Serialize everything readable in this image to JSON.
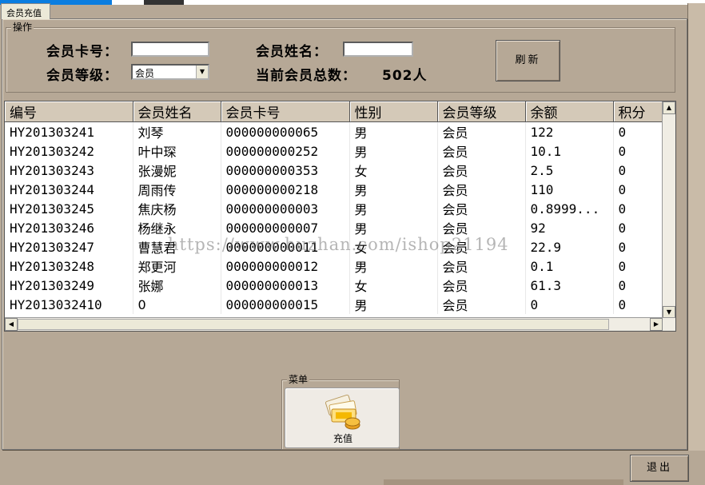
{
  "tab": {
    "label": "会员充值"
  },
  "operation": {
    "title": "操作",
    "card_no_label": "会员卡号：",
    "card_no_value": "",
    "name_label": "会员姓名：",
    "name_value": "",
    "level_label": "会员等级：",
    "level_selected": "会员",
    "total_label": "当前会员总数：",
    "total_value": "502人",
    "refresh_label": "刷新"
  },
  "grid": {
    "columns": [
      "编号",
      "会员姓名",
      "会员卡号",
      "性别",
      "会员等级",
      "余额",
      "积分"
    ],
    "rows": [
      [
        "HY201303241",
        "刘琴",
        "000000000065",
        "男",
        "会员",
        "122",
        "0"
      ],
      [
        "HY201303242",
        "叶中琛",
        "000000000252",
        "男",
        "会员",
        "10.1",
        "0"
      ],
      [
        "HY201303243",
        "张漫妮",
        "000000000353",
        "女",
        "会员",
        "2.5",
        "0"
      ],
      [
        "HY201303244",
        "周雨传",
        "000000000218",
        "男",
        "会员",
        "110",
        "0"
      ],
      [
        "HY201303245",
        "焦庆杨",
        "000000000003",
        "男",
        "会员",
        "0.8999...",
        "0"
      ],
      [
        "HY201303246",
        "杨继永",
        "000000000007",
        "男",
        "会员",
        "92",
        "0"
      ],
      [
        "HY201303247",
        "曹慧君",
        "000000000011",
        "女",
        "会员",
        "22.9",
        "0"
      ],
      [
        "HY201303248",
        "郑更河",
        "000000000012",
        "男",
        "会员",
        "0.1",
        "0"
      ],
      [
        "HY201303249",
        "张娜",
        "000000000013",
        "女",
        "会员",
        "61.3",
        "0"
      ],
      [
        "HY2013032410",
        "0",
        "000000000015",
        "男",
        "会员",
        "0",
        "0"
      ]
    ]
  },
  "watermark": "https://www.huzhan.com/ishop21194",
  "menu": {
    "title": "菜单",
    "recharge_label": "充值",
    "recharge_icon": "money-stack-icon"
  },
  "exit_label": "退出"
}
